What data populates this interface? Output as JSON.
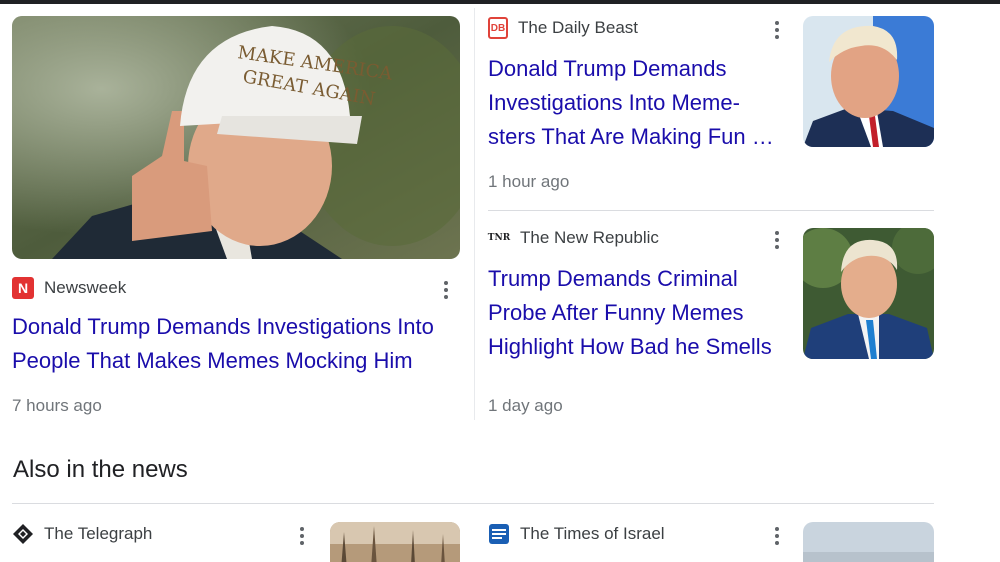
{
  "featured": {
    "source": "Newsweek",
    "source_logo_letter": "N",
    "source_color": "#e23232",
    "headline": "Donald Trump Demands Investigations Into People That Makes Memes Mocking Him",
    "time": "7 hours ago",
    "image_alt": "Man in white cap pointing",
    "cap_text_line1": "MAKE AMERICA",
    "cap_text_line2": "GREAT AGAIN"
  },
  "stories": [
    {
      "source": "The Daily Beast",
      "source_logo_letter": "DB",
      "source_color": "#e0433a",
      "headline": "Donald Trump Demands Investigations Into Meme-sters That Are Making Fun …",
      "time": "1 hour ago",
      "image_alt": "Man in suit with blue background"
    },
    {
      "source": "The New Republic",
      "source_logo_letter": "TNR",
      "source_color": "#202124",
      "headline": "Trump Demands Criminal Probe After Funny Memes Highlight How Bad he Smells",
      "time": "1 day ago",
      "image_alt": "Man in blue suit outdoors"
    }
  ],
  "also_in_news": {
    "title": "Also in the news",
    "items": [
      {
        "source": "The Telegraph",
        "source_color": "#202124"
      },
      {
        "source": "The Times of Israel",
        "source_color": "#1a5fb4"
      }
    ]
  },
  "colors": {
    "link": "#1a0dab",
    "meta": "#70757a",
    "divider": "#dadce0"
  }
}
